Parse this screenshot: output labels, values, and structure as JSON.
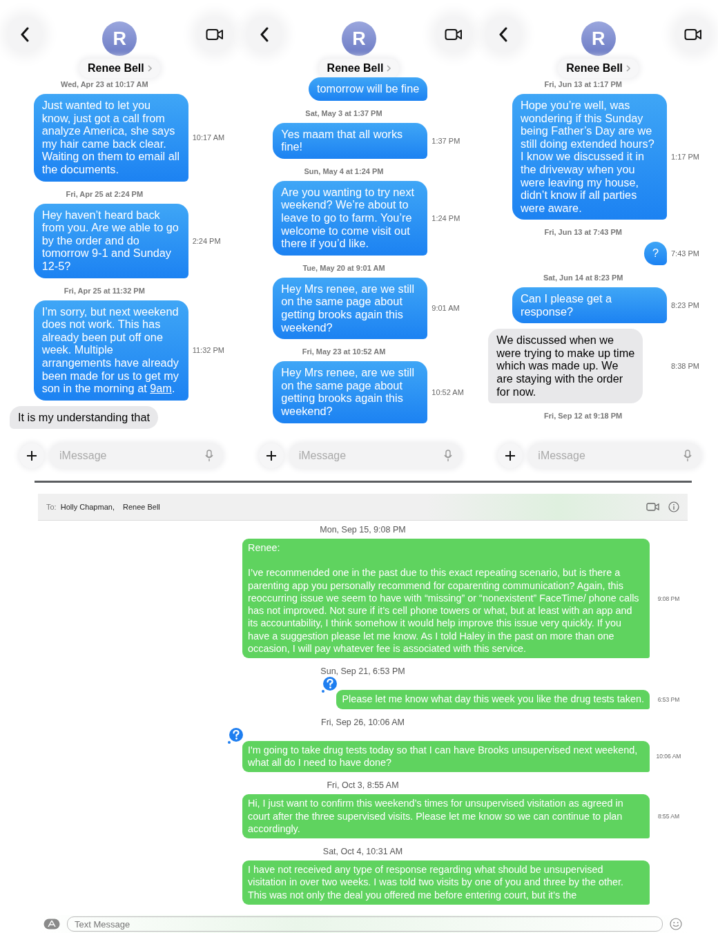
{
  "phones": [
    {
      "contact": {
        "initial": "R",
        "name": "Renee Bell"
      },
      "items": [
        {
          "kind": "timestamp",
          "text": "Wed, Apr 23 at 10:17 AM"
        },
        {
          "kind": "sent",
          "text": "Just wanted to let you know, just got a call from analyze America, she says my hair came back clear. Waiting on them to email all the documents.",
          "time": "10:17 AM"
        },
        {
          "kind": "timestamp",
          "text": "Fri, Apr 25 at 2:24 PM"
        },
        {
          "kind": "sent",
          "text": "Hey haven’t heard back from you. Are we able to go by the order and do tomorrow 9-1 and Sunday 12-5?",
          "time": "2:24 PM"
        },
        {
          "kind": "timestamp",
          "text": "Fri, Apr 25 at 11:32 PM"
        },
        {
          "kind": "sent",
          "text": "I’m sorry, but next weekend does not work. This has already been put off one week. Multiple arrangements have already been made for us to get my son in the morning at ",
          "link": "9am",
          "after": ".",
          "time": "11:32 PM"
        },
        {
          "kind": "received",
          "text": "It is my understanding that"
        }
      ],
      "composer": {
        "placeholder": "iMessage"
      }
    },
    {
      "contact": {
        "initial": "R",
        "name": "Renee Bell"
      },
      "items": [
        {
          "kind": "sent",
          "text": "tomorrow will be fine"
        },
        {
          "kind": "timestamp",
          "text": "Sat, May 3 at 1:37 PM"
        },
        {
          "kind": "sent",
          "text": "Yes maam that all works fine!",
          "time": "1:37 PM"
        },
        {
          "kind": "timestamp",
          "text": "Sun, May 4 at 1:24 PM"
        },
        {
          "kind": "sent",
          "text": "Are you wanting to try next weekend? We’re about to leave to go to farm. You’re welcome to come visit out there if you’d like.",
          "time": "1:24 PM"
        },
        {
          "kind": "timestamp",
          "text": "Tue, May 20 at 9:01 AM"
        },
        {
          "kind": "sent",
          "text": "Hey Mrs renee, are we still on the same page about getting brooks again this weekend?",
          "time": "9:01 AM"
        },
        {
          "kind": "timestamp",
          "text": "Fri, May 23 at 10:52 AM"
        },
        {
          "kind": "sent",
          "text": "Hey Mrs renee, are we still on the same page about getting brooks again this weekend?",
          "time": "10:52 AM"
        }
      ],
      "composer": {
        "placeholder": "iMessage"
      }
    },
    {
      "contact": {
        "initial": "R",
        "name": "Renee Bell"
      },
      "items": [
        {
          "kind": "timestamp",
          "text": "Fri, Jun 13 at 1:17 PM"
        },
        {
          "kind": "sent",
          "text": "Hope you’re well, was wondering if this Sunday being Father’s Day are we still doing extended hours? I know we discussed it in the driveway when you were leaving my house, didn’t know if all parties were aware.",
          "time": "1:17 PM"
        },
        {
          "kind": "timestamp",
          "text": "Fri, Jun 13 at 7:43 PM"
        },
        {
          "kind": "sent",
          "text": "?",
          "time": "7:43 PM"
        },
        {
          "kind": "timestamp",
          "text": "Sat, Jun 14 at 8:23 PM"
        },
        {
          "kind": "sent",
          "text": "Can I please get a response?",
          "time": "8:23 PM"
        },
        {
          "kind": "received",
          "text": "We discussed when we were trying to make up time which was made up. We are staying with the order for now.",
          "time": "8:38 PM"
        },
        {
          "kind": "timestamp",
          "text": "Fri, Sep 12 at 9:18 PM"
        }
      ],
      "composer": {
        "placeholder": "iMessage"
      }
    }
  ],
  "mac": {
    "to_label": "To:",
    "recipients": [
      "Holly Chapman,",
      "Renee Bell"
    ],
    "items": [
      {
        "kind": "timestamp",
        "text": "Mon, Sep 15, 9:08 PM"
      },
      {
        "kind": "sent",
        "paragraphs": [
          "Renee:",
          "I’ve recommended one in the past due to this exact repeating scenario, but is there a parenting app you personally recommend for coparenting communication? Again, this reoccurring issue we seem to have with “missing” or “nonexistent” FaceTime/ phone calls has not improved. Not sure if it’s cell phone towers or what, but at least with an app and its accountability, I think somehow it would help improve this issue very quickly. If you have a suggestion please let me know. As I told Haley in the past on more than one occasion, I will pay whatever fee is associated with this service."
        ],
        "time": "9:08 PM",
        "failed": false
      },
      {
        "kind": "timestamp",
        "text": "Sun, Sep 21, 6:53 PM"
      },
      {
        "kind": "sent",
        "paragraphs": [
          "Please let me know what day this week you like the drug tests taken."
        ],
        "time": "6:53 PM",
        "failed": true
      },
      {
        "kind": "timestamp",
        "text": "Fri, Sep 26, 10:06 AM"
      },
      {
        "kind": "sent",
        "paragraphs": [
          "I'm going to take drug tests today so that I can have Brooks unsupervised next weekend, what all do I need to have done?"
        ],
        "time": "10:06 AM",
        "failed": true
      },
      {
        "kind": "timestamp",
        "text": "Fri, Oct 3, 8:55 AM"
      },
      {
        "kind": "sent",
        "paragraphs": [
          "Hi, I just want to confirm this weekend’s times for unsupervised visitation as agreed in court after the three supervised visits. Please let me know so we can continue to plan accordingly."
        ],
        "time": "8:55 AM",
        "failed": false
      },
      {
        "kind": "timestamp",
        "text": "Sat, Oct 4, 10:31 AM"
      },
      {
        "kind": "sent",
        "paragraphs": [
          "I have not received any type of response regarding what should be unsupervised visitation in over two weeks. I was told two visits by one of you and three by the other. This was not only the deal you offered me before entering court, but it’s the"
        ],
        "failed": false
      }
    ],
    "composer": {
      "placeholder": "Text Message"
    }
  }
}
